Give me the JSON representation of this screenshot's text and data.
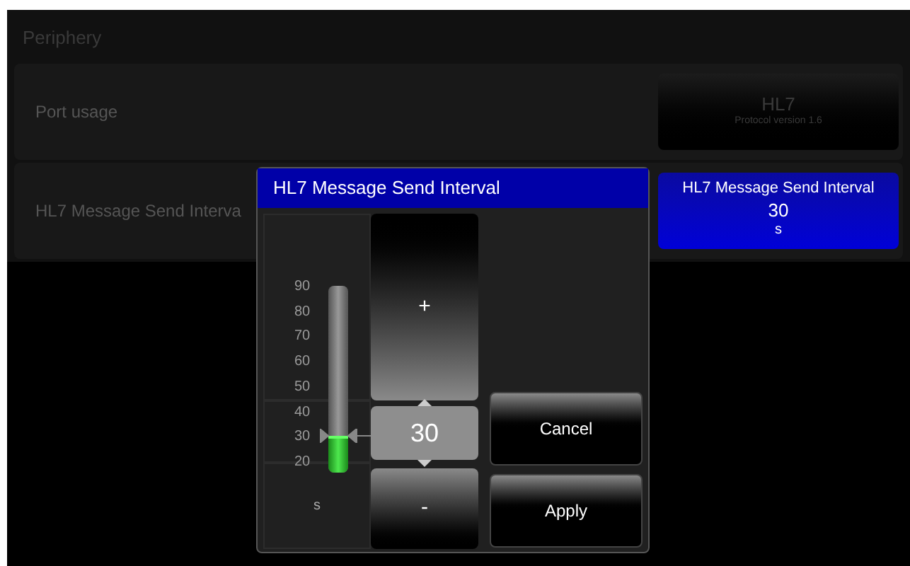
{
  "page": {
    "title": "Periphery"
  },
  "settings": [
    {
      "label": "Port usage",
      "button": {
        "title": "HL7",
        "subtitle": "Protocol version 1.6",
        "selected": false
      }
    },
    {
      "label": "HL7 Message Send Interva",
      "button": {
        "title": "HL7 Message Send Interval",
        "value": "30",
        "unit": "s",
        "selected": true
      }
    }
  ],
  "dialog": {
    "title": "HL7 Message Send Interval",
    "scale": {
      "ticks": [
        "90",
        "80",
        "70",
        "60",
        "50",
        "40",
        "30",
        "20"
      ],
      "level": 0.2
    },
    "unit": "s",
    "increment": "+",
    "value": "30",
    "decrement": "-",
    "buttons": [
      "Cancel",
      "Apply"
    ]
  }
}
